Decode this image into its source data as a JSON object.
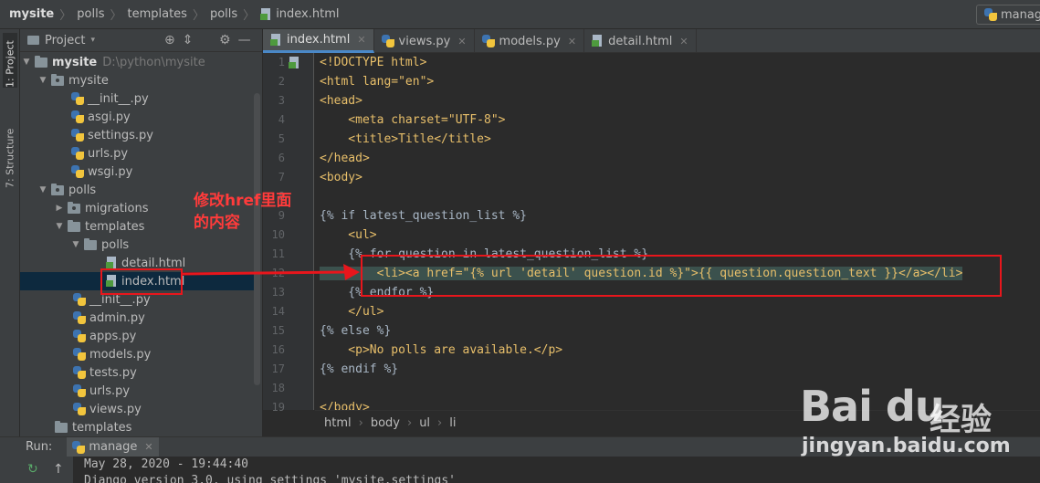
{
  "breadcrumb": [
    "mysite",
    "polls",
    "templates",
    "polls",
    "index.html"
  ],
  "run_config": {
    "label": "manag"
  },
  "tool_strip": {
    "project": "1: Project",
    "structure": "7: Structure"
  },
  "project_panel": {
    "title": "Project",
    "caret": "▾"
  },
  "tree": [
    {
      "label": "mysite",
      "path": "D:\\python\\mysite",
      "type": "root"
    },
    {
      "label": "mysite",
      "type": "folder"
    },
    {
      "label": "__init__.py",
      "type": "py"
    },
    {
      "label": "asgi.py",
      "type": "py"
    },
    {
      "label": "settings.py",
      "type": "py"
    },
    {
      "label": "urls.py",
      "type": "py"
    },
    {
      "label": "wsgi.py",
      "type": "py"
    },
    {
      "label": "polls",
      "type": "folder"
    },
    {
      "label": "migrations",
      "type": "folder"
    },
    {
      "label": "templates",
      "type": "folder"
    },
    {
      "label": "polls",
      "type": "folder"
    },
    {
      "label": "detail.html",
      "type": "html"
    },
    {
      "label": "index.html",
      "type": "html",
      "selected": true
    },
    {
      "label": "__init__.py",
      "type": "py"
    },
    {
      "label": "admin.py",
      "type": "py"
    },
    {
      "label": "apps.py",
      "type": "py"
    },
    {
      "label": "models.py",
      "type": "py"
    },
    {
      "label": "tests.py",
      "type": "py"
    },
    {
      "label": "urls.py",
      "type": "py"
    },
    {
      "label": "views.py",
      "type": "py"
    },
    {
      "label": "templates",
      "type": "folder"
    }
  ],
  "tabs": [
    {
      "label": "index.html",
      "active": true,
      "type": "html"
    },
    {
      "label": "views.py",
      "type": "py"
    },
    {
      "label": "models.py",
      "type": "py"
    },
    {
      "label": "detail.html",
      "type": "html"
    }
  ],
  "code_lines": [
    "<!DOCTYPE html>",
    "<html lang=\"en\">",
    "<head>",
    "    <meta charset=\"UTF-8\">",
    "    <title>Title</title>",
    "</head>",
    "<body>",
    "",
    "{% if latest_question_list %}",
    "    <ul>",
    "    {% for question in latest_question_list %}",
    "        <li><a href=\"{% url 'detail' question.id %}\">{{ question.question_text }}</a></li>",
    "    {% endfor %}",
    "    </ul>",
    "{% else %}",
    "    <p>No polls are available.</p>",
    "{% endif %}",
    "",
    "</body>"
  ],
  "line_numbers": [
    "1",
    "2",
    "3",
    "4",
    "5",
    "6",
    "7",
    "8",
    "9",
    "10",
    "11",
    "12",
    "13",
    "14",
    "15",
    "16",
    "17",
    "18",
    "19"
  ],
  "editor_breadcrumb": [
    "html",
    "body",
    "ul",
    "li"
  ],
  "run_panel": {
    "label": "Run:",
    "tab": "manage"
  },
  "console_lines": [
    "May 28, 2020 - 19:44:40",
    "Django version 3.0, using settings 'mysite.settings'"
  ],
  "annotation": {
    "text": "修改href里面的内容",
    "color": "#e8161c"
  },
  "watermark": {
    "logo": "Bai du",
    "brand": "经验",
    "url": "jingyan.baidu.com"
  }
}
